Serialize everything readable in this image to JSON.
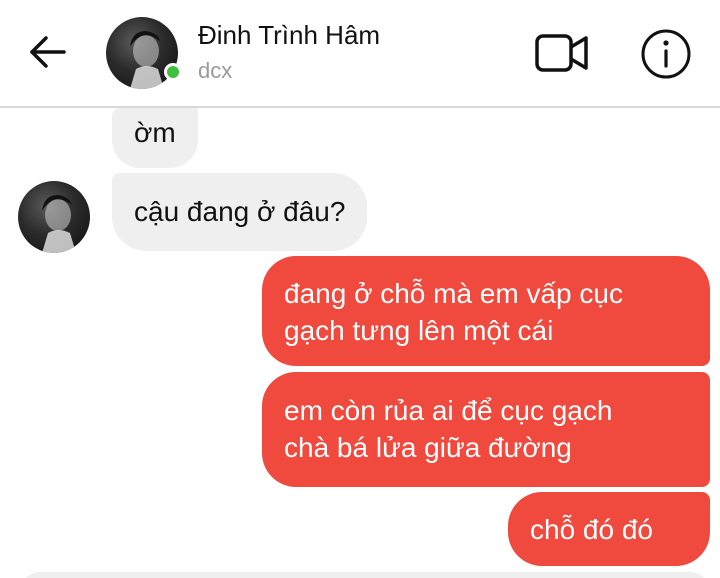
{
  "header": {
    "contact_name": "Đinh Trình Hâm",
    "contact_status": "dcx",
    "online_color": "#3fbf3f",
    "icons": [
      "arrow-left-icon",
      "video-call-icon",
      "info-icon"
    ]
  },
  "messages": [
    {
      "sender": "them",
      "text": "ờm"
    },
    {
      "sender": "them",
      "text": "cậu đang ở đâu?"
    },
    {
      "sender": "me",
      "lines": [
        "đang ở chỗ mà em vấp cục",
        "gạch tưng lên một cái"
      ]
    },
    {
      "sender": "me",
      "lines": [
        "em còn rủa ai để cục gạch",
        "chà bá lửa giữa đường"
      ]
    },
    {
      "sender": "me",
      "text": "chỗ đó đó"
    }
  ],
  "colors": {
    "outgoing_bubble": "#f0493e",
    "incoming_bubble": "#efefef"
  }
}
